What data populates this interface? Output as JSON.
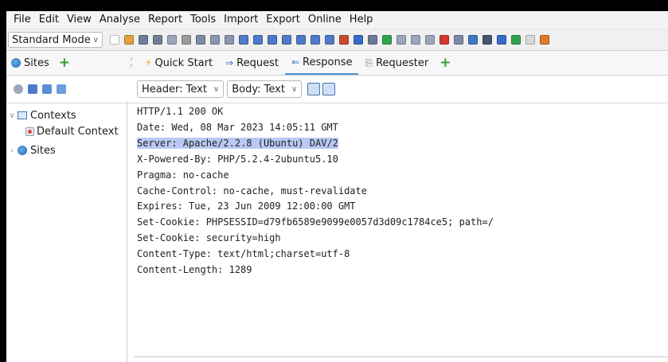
{
  "menubar": {
    "items": [
      "File",
      "Edit",
      "View",
      "Analyse",
      "Report",
      "Tools",
      "Import",
      "Export",
      "Online",
      "Help"
    ]
  },
  "toolbar": {
    "mode_select": "Standard Mode",
    "icons": [
      {
        "name": "new-session-icon",
        "color": "#ffffff"
      },
      {
        "name": "open-session-icon",
        "color": "#e0a23a"
      },
      {
        "name": "persist-session-icon",
        "color": "#6f7f99"
      },
      {
        "name": "snapshot-session-icon",
        "color": "#6f7f99"
      },
      {
        "name": "session-properties-icon",
        "color": "#9aa7bd"
      },
      {
        "name": "options-icon",
        "color": "#9b9b9b"
      },
      {
        "name": "export-icon",
        "color": "#7c8aa5"
      },
      {
        "name": "layout-full-icon",
        "color": "#8a96b0"
      },
      {
        "name": "layout-tabs-icon",
        "color": "#8a96b0"
      },
      {
        "name": "layout-panel-1-icon",
        "color": "#4f7ac9"
      },
      {
        "name": "layout-panel-2-icon",
        "color": "#4f7ac9"
      },
      {
        "name": "layout-panel-3-icon",
        "color": "#4f7ac9"
      },
      {
        "name": "layout-panel-4-icon",
        "color": "#4f7ac9"
      },
      {
        "name": "show-all-tabs-icon",
        "color": "#4f7ac9"
      },
      {
        "name": "hide-tabs-icon",
        "color": "#4f7ac9"
      },
      {
        "name": "pin-tabs-icon",
        "color": "#4f7ac9"
      },
      {
        "name": "spider-icon",
        "color": "#c84a2e"
      },
      {
        "name": "ajax-spider-icon",
        "color": "#3a6ac8"
      },
      {
        "name": "scan-policy-icon",
        "color": "#6c7a99"
      },
      {
        "name": "break-on-icon",
        "color": "#2ea44f"
      },
      {
        "name": "step-icon",
        "color": "#9aa7bd"
      },
      {
        "name": "continue-icon",
        "color": "#9aa7bd"
      },
      {
        "name": "drop-icon",
        "color": "#9aa7bd"
      },
      {
        "name": "delete-icon",
        "color": "#d0392b"
      },
      {
        "name": "alerts-icon",
        "color": "#7c8aa5"
      },
      {
        "name": "sites-tree-icon",
        "color": "#3e79c4"
      },
      {
        "name": "hud-icon",
        "color": "#47566e"
      },
      {
        "name": "manual-explore-icon",
        "color": "#3a6ac8"
      },
      {
        "name": "forced-user-icon",
        "color": "#2ea44f"
      },
      {
        "name": "notes-icon",
        "color": "#d8d8d8"
      },
      {
        "name": "bug-icon",
        "color": "#e07a28"
      }
    ]
  },
  "left_tabs": {
    "sites_label": "Sites",
    "add_symbol": "+"
  },
  "right_tabs": [
    {
      "label": "Quick Start",
      "glyph": "⚡",
      "active": false
    },
    {
      "label": "Request",
      "glyph": "⇒",
      "active": false
    },
    {
      "label": "Response",
      "glyph": "⇐",
      "active": true
    },
    {
      "label": "Requester",
      "glyph": "⎘",
      "active": false
    }
  ],
  "right_tabs_add": "+",
  "left_subtoolbar_icons": [
    "show-in-context-icon",
    "add-context-icon",
    "import-context-icon",
    "export-context-icon"
  ],
  "response_toolbar": {
    "header_select": "Header: Text",
    "body_select": "Body: Text"
  },
  "tree": {
    "contexts_label": "Contexts",
    "default_context_label": "Default Context",
    "sites_label": "Sites"
  },
  "response": {
    "status_line": "HTTP/1.1 200 OK",
    "date": "Date: Wed, 08 Mar 2023 14:05:11 GMT",
    "server": "Server: Apache/2.2.8 (Ubuntu) DAV/2",
    "x_powered_by": "X-Powered-By: PHP/5.2.4-2ubuntu5.10",
    "pragma": "Pragma: no-cache",
    "cache_control": "Cache-Control: no-cache, must-revalidate",
    "expires": "Expires: Tue, 23 Jun 2009 12:00:00 GMT",
    "set_cookie_1": "Set-Cookie: PHPSESSID=d79fb6589e9099e0057d3d09c1784ce5; path=/",
    "set_cookie_2": "Set-Cookie: security=high",
    "content_type": "Content-Type: text/html;charset=utf-8",
    "content_length": "Content-Length: 1289"
  },
  "colors": {
    "highlight": "#b9c9f3",
    "active_tab": "#4a90d9",
    "plus_green": "#2f9e2f"
  }
}
